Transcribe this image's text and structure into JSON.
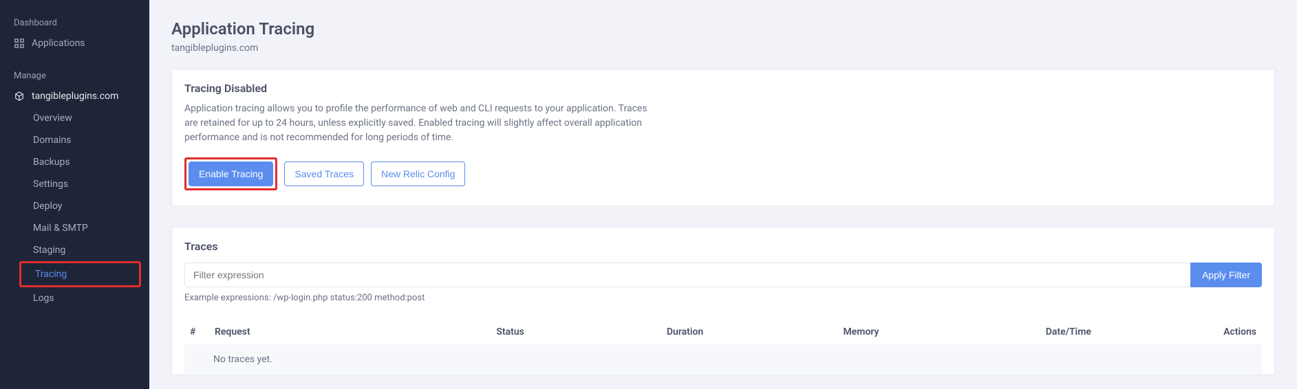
{
  "sidebar": {
    "dashboard_label": "Dashboard",
    "applications_label": "Applications",
    "manage_label": "Manage",
    "site_label": "tangibleplugins.com",
    "items": [
      {
        "label": "Overview"
      },
      {
        "label": "Domains"
      },
      {
        "label": "Backups"
      },
      {
        "label": "Settings"
      },
      {
        "label": "Deploy"
      },
      {
        "label": "Mail & SMTP"
      },
      {
        "label": "Staging"
      },
      {
        "label": "Tracing"
      },
      {
        "label": "Logs"
      }
    ]
  },
  "page": {
    "title": "Application Tracing",
    "subtitle": "tangibleplugins.com"
  },
  "status_card": {
    "title": "Tracing Disabled",
    "description": "Application tracing allows you to profile the performance of web and CLI requests to your application. Traces are retained for up to 24 hours, unless explicitly saved. Enabled tracing will slightly affect overall application performance and is not recommended for long periods of time.",
    "enable_label": "Enable Tracing",
    "saved_label": "Saved Traces",
    "newrelic_label": "New Relic Config"
  },
  "traces": {
    "title": "Traces",
    "filter_placeholder": "Filter expression",
    "filter_value": "",
    "apply_label": "Apply Filter",
    "example_text": "Example expressions: /wp-login.php status:200 method:post",
    "columns": {
      "hash": "#",
      "request": "Request",
      "status": "Status",
      "duration": "Duration",
      "memory": "Memory",
      "datetime": "Date/Time",
      "actions": "Actions"
    },
    "empty_text": "No traces yet."
  }
}
